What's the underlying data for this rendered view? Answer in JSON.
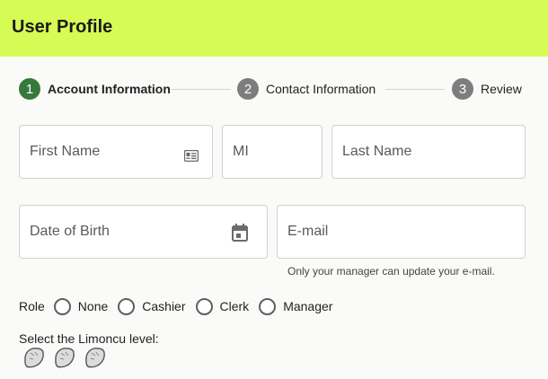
{
  "header": {
    "title": "User Profile",
    "color": "#d7fb55"
  },
  "stepper": {
    "steps": [
      {
        "number": "1",
        "label": "Account Information",
        "active": true
      },
      {
        "number": "2",
        "label": "Contact Information",
        "active": false
      },
      {
        "number": "3",
        "label": "Review",
        "active": false
      }
    ],
    "active_color": "#367a3b",
    "inactive_color": "#7d7d7d"
  },
  "form": {
    "first_name": {
      "placeholder": "First Name",
      "value": "",
      "icon": "id-card-icon"
    },
    "middle_initial": {
      "placeholder": "MI",
      "value": ""
    },
    "last_name": {
      "placeholder": "Last Name",
      "value": ""
    },
    "date_of_birth": {
      "placeholder": "Date of Birth",
      "value": "",
      "icon": "calendar-icon"
    },
    "email": {
      "placeholder": "E-mail",
      "value": "",
      "helper": "Only your manager can update your e-mail."
    },
    "role": {
      "label": "Role",
      "options": [
        "None",
        "Cashier",
        "Clerk",
        "Manager"
      ],
      "selected": null
    },
    "limoncu": {
      "label": "Select the Limoncu level:",
      "icon": "lemon-icon",
      "max": 3,
      "level": 0
    }
  }
}
